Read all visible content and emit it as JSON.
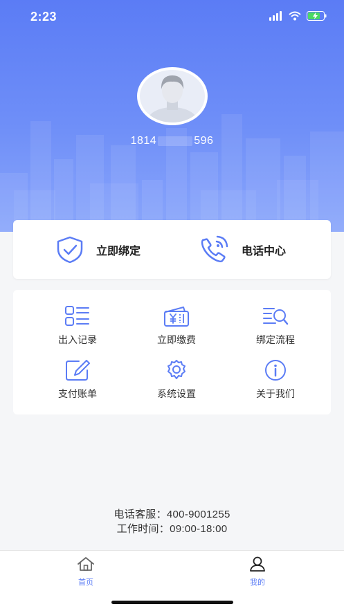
{
  "status_bar": {
    "time": "2:23",
    "battery_color": "#4cd964"
  },
  "colors": {
    "accent": "#5b7cf5",
    "icon_blue": "#5b7cf5",
    "hero_top": "#5b7cf5",
    "hero_bottom": "#8aa6fb"
  },
  "profile": {
    "phone_prefix": "1814",
    "phone_suffix": "596",
    "avatar_icon": "user-avatar-icon"
  },
  "quick_actions": [
    {
      "label": "立即绑定",
      "icon": "shield-check-icon"
    },
    {
      "label": "电话中心",
      "icon": "phone-call-icon"
    }
  ],
  "grid": [
    {
      "label": "出入记录",
      "icon": "list-grid-icon"
    },
    {
      "label": "立即缴费",
      "icon": "yen-ticket-icon"
    },
    {
      "label": "绑定流程",
      "icon": "list-search-icon"
    },
    {
      "label": "支付账单",
      "icon": "edit-pencil-icon"
    },
    {
      "label": "系统设置",
      "icon": "gear-icon"
    },
    {
      "label": "关于我们",
      "icon": "info-icon"
    }
  ],
  "contact": {
    "hotline": "电话客服：400-9001255",
    "hours": "工作时间：09:00-18:00"
  },
  "tabs": [
    {
      "label": "首页",
      "icon": "home-icon"
    },
    {
      "label": "我的",
      "icon": "person-icon"
    }
  ]
}
